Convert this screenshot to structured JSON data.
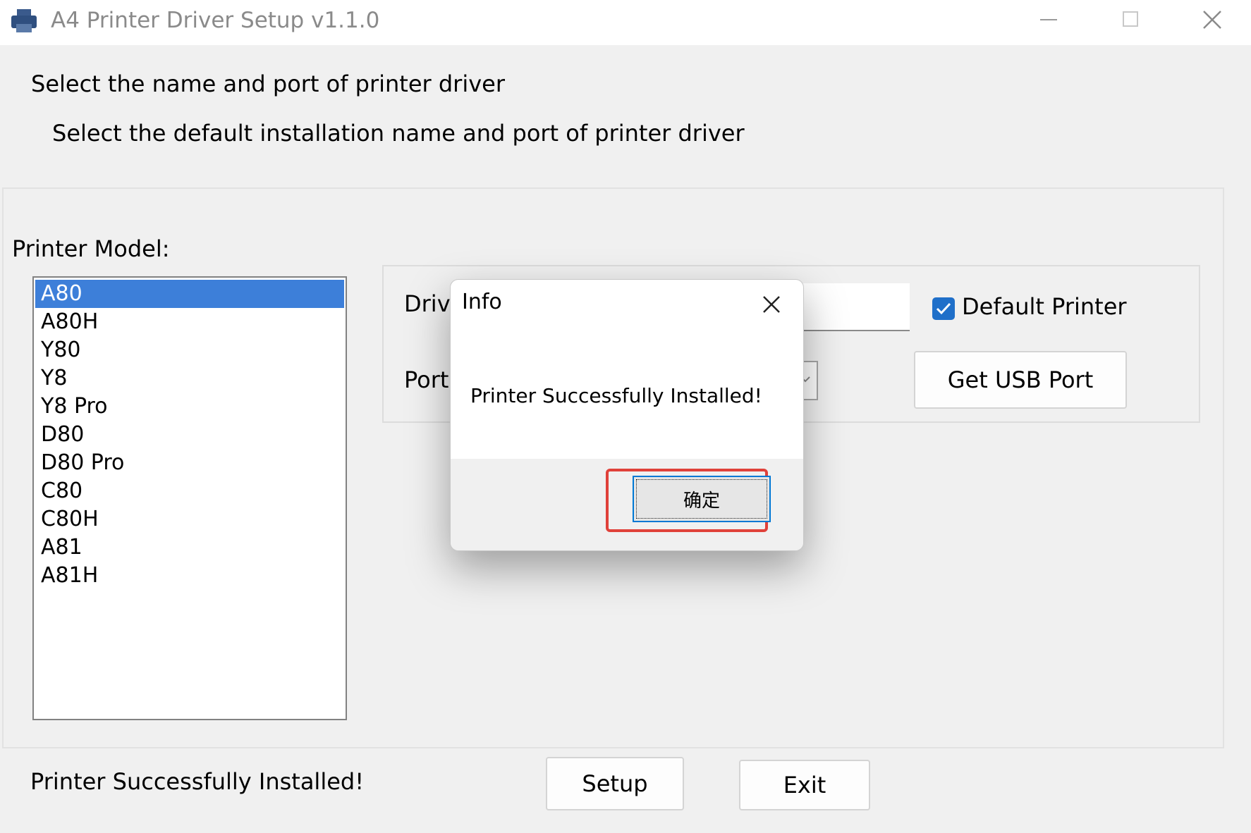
{
  "window": {
    "title": "A4 Printer Driver Setup v1.1.0",
    "icon": "printer-icon"
  },
  "header": {
    "title": "Select the name and port of printer driver",
    "subtitle": "Select the default installation name and port of printer driver"
  },
  "model": {
    "label": "Printer Model:",
    "items": [
      "A80",
      "A80H",
      "Y80",
      "Y8",
      "Y8 Pro",
      "D80",
      "D80 Pro",
      "C80",
      "C80H",
      "A81",
      "A81H"
    ],
    "selected": "A80"
  },
  "driver": {
    "label_visible": "Driv",
    "value": ""
  },
  "port": {
    "label_visible": "Port"
  },
  "default_printer": {
    "label": "Default Printer",
    "checked": true
  },
  "buttons": {
    "usb": "Get USB Port",
    "setup": "Setup",
    "exit": "Exit"
  },
  "status": "Printer Successfully Installed!",
  "dialog": {
    "title": "Info",
    "message": "Printer Successfully Installed!",
    "ok": "确定"
  },
  "colors": {
    "selection": "#3d7fd9",
    "checkbox": "#1f6fc9",
    "highlight": "#e0413a"
  }
}
